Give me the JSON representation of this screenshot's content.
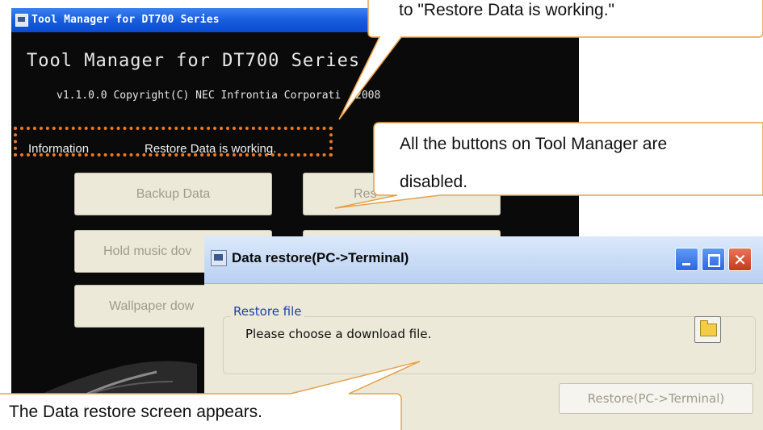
{
  "tool_manager": {
    "window_title": "Tool Manager for DT700 Series",
    "heading": "Tool Manager for DT700 Series",
    "copyright": "v1.1.0.0 Copyright(C) NEC Infrontia Corporati",
    "copyright_tail": "2008",
    "info_label": "Information",
    "info_status": "Restore Data is working.",
    "buttons": [
      {
        "label": "Backup Data"
      },
      {
        "label": "Res"
      },
      {
        "label": "Hold music dov"
      },
      {
        "label": ""
      },
      {
        "label": "Wallpaper dow"
      }
    ]
  },
  "dialog": {
    "title": "Data restore(PC->Terminal)",
    "group_label": "Restore file",
    "prompt": "Please choose a download file.",
    "restore_button": "Restore(PC->Terminal)"
  },
  "callouts": {
    "top_text": "to \"Restore Data is working.\"",
    "right_line1": "All the buttons on Tool Manager are",
    "right_line2": "disabled.",
    "bottom_text": "The Data restore screen appears."
  },
  "colors": {
    "highlight": "#f07820",
    "callout_border": "#e8a048",
    "group_label": "#1f3fa8"
  },
  "icons": [
    "app-icon",
    "folder-icon",
    "minimize-icon",
    "maximize-icon",
    "close-icon"
  ]
}
